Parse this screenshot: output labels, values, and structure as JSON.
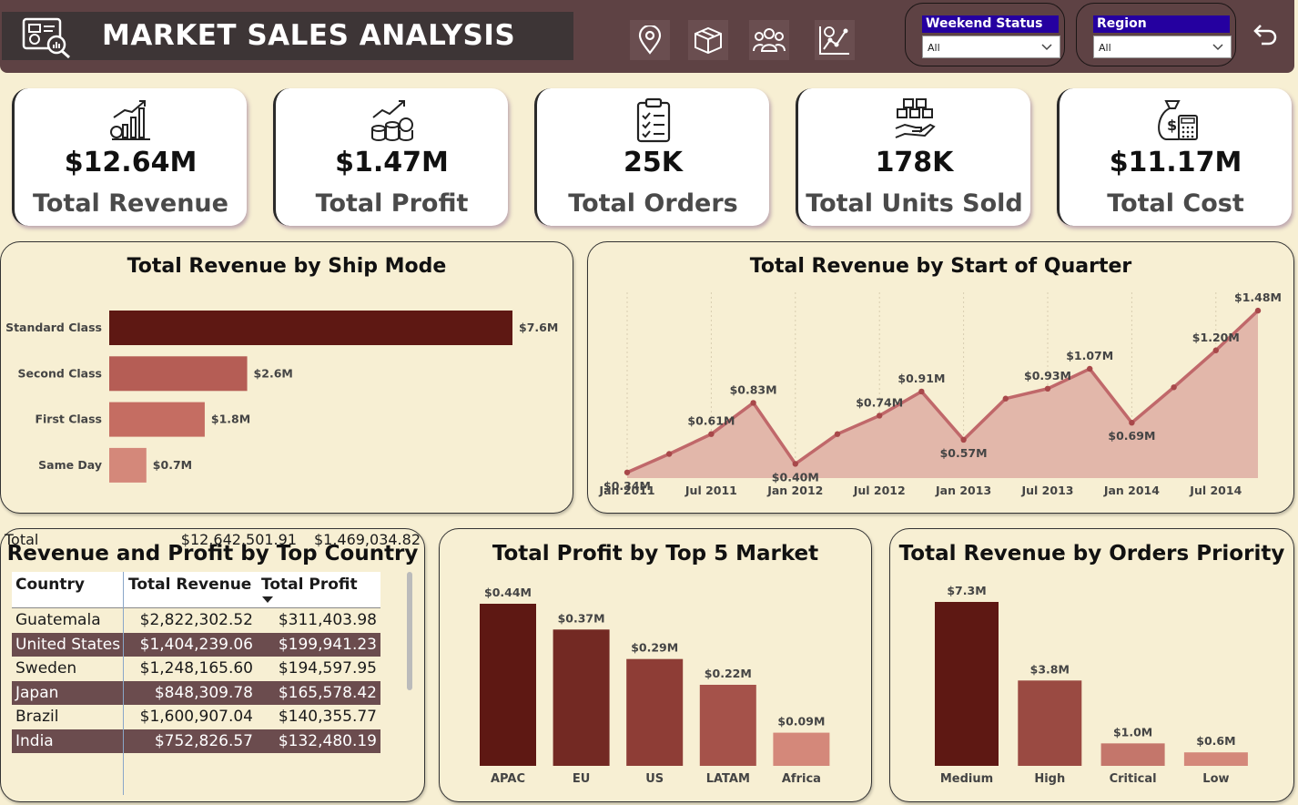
{
  "header": {
    "title": "MARKET SALES ANALYSIS",
    "nav": [
      {
        "name": "location-pin-icon"
      },
      {
        "name": "package-box-icon"
      },
      {
        "name": "people-group-icon"
      },
      {
        "name": "analytics-chart-icon"
      }
    ],
    "filters": [
      {
        "label": "Weekend Status",
        "value": "All"
      },
      {
        "label": "Region",
        "value": "All"
      }
    ],
    "back_icon": "back-arrow-icon"
  },
  "kpis": [
    {
      "value": "$12.64M",
      "label": "Total Revenue",
      "icon": "revenue-chart-icon"
    },
    {
      "value": "$1.47M",
      "label": "Total Profit",
      "icon": "profit-coins-icon"
    },
    {
      "value": "25K",
      "label": "Total Orders",
      "icon": "clipboard-icon"
    },
    {
      "value": "178K",
      "label": "Total Units Sold",
      "icon": "boxes-hand-icon"
    },
    {
      "value": "$11.17M",
      "label": "Total Cost",
      "icon": "money-bag-calculator-icon"
    }
  ],
  "colors": {
    "header": "#5e4244",
    "panel": "#f7efd3",
    "dark_bar": "#5e1813",
    "accent": "#c0686a"
  },
  "chart_data": [
    {
      "type": "bar",
      "orientation": "horizontal",
      "title": "Total Revenue by Ship Mode",
      "categories": [
        "Standard Class",
        "Second Class",
        "First Class",
        "Same Day"
      ],
      "values": [
        7.6,
        2.6,
        1.8,
        0.7
      ],
      "labels": [
        "$7.6M",
        "$2.6M",
        "$1.8M",
        "$0.7M"
      ],
      "colors": [
        "#5e1813",
        "#b55d55",
        "#c56d62",
        "#d4887a"
      ],
      "xlim": [
        0,
        7.6
      ]
    },
    {
      "type": "area",
      "title": "Total Revenue by Start of Quarter",
      "x_ticks": [
        "Jan 2011",
        "Jul 2011",
        "Jan 2012",
        "Jul 2012",
        "Jan 2013",
        "Jul 2013",
        "Jan 2014",
        "Jul 2014"
      ],
      "values": [
        0.34,
        0.47,
        0.61,
        0.83,
        0.4,
        0.61,
        0.74,
        0.91,
        0.57,
        0.86,
        0.93,
        1.07,
        0.69,
        0.94,
        1.2,
        1.48
      ],
      "labels": [
        "$0.34M",
        "",
        "$0.61M",
        "$0.83M",
        "$0.40M",
        "",
        "$0.74M",
        "$0.91M",
        "$0.57M",
        "",
        "$0.93M",
        "$1.07M",
        "$0.69M",
        "",
        "$1.20M",
        "$1.48M"
      ],
      "ylim": [
        0.3,
        1.5
      ]
    },
    {
      "type": "table",
      "title": "Revenue and Profit by Top Country",
      "columns": [
        "Country",
        "Total Revenue",
        "Total Profit"
      ],
      "rows": [
        [
          "Guatemala",
          "$2,822,302.52",
          "$311,403.98"
        ],
        [
          "United States",
          "$1,404,239.06",
          "$199,941.23"
        ],
        [
          "Sweden",
          "$1,248,165.60",
          "$194,597.95"
        ],
        [
          "Japan",
          "$848,309.78",
          "$165,578.42"
        ],
        [
          "Brazil",
          "$1,600,907.04",
          "$140,355.77"
        ],
        [
          "India",
          "$752,826.57",
          "$132,480.19"
        ]
      ],
      "total": [
        "Total",
        "$12,642,501.91",
        "$1,469,034.82"
      ]
    },
    {
      "type": "bar",
      "title": "Total Profit by Top 5 Market",
      "categories": [
        "APAC",
        "EU",
        "US",
        "LATAM",
        "Africa"
      ],
      "values": [
        0.44,
        0.37,
        0.29,
        0.22,
        0.09
      ],
      "labels": [
        "$0.44M",
        "$0.37M",
        "$0.29M",
        "$0.22M",
        "$0.09M"
      ],
      "colors": [
        "#5e1813",
        "#732923",
        "#8e3d36",
        "#a5524a",
        "#d4887a"
      ],
      "ylim": [
        0,
        0.44
      ]
    },
    {
      "type": "bar",
      "title": "Total Revenue by Orders Priority",
      "categories": [
        "Medium",
        "High",
        "Critical",
        "Low"
      ],
      "values": [
        7.3,
        3.8,
        1.0,
        0.6
      ],
      "labels": [
        "$7.3M",
        "$3.8M",
        "$1.0M",
        "$0.6M"
      ],
      "colors": [
        "#5e1813",
        "#9a4a42",
        "#c4766b",
        "#d4887a"
      ],
      "ylim": [
        0,
        7.3
      ]
    }
  ]
}
